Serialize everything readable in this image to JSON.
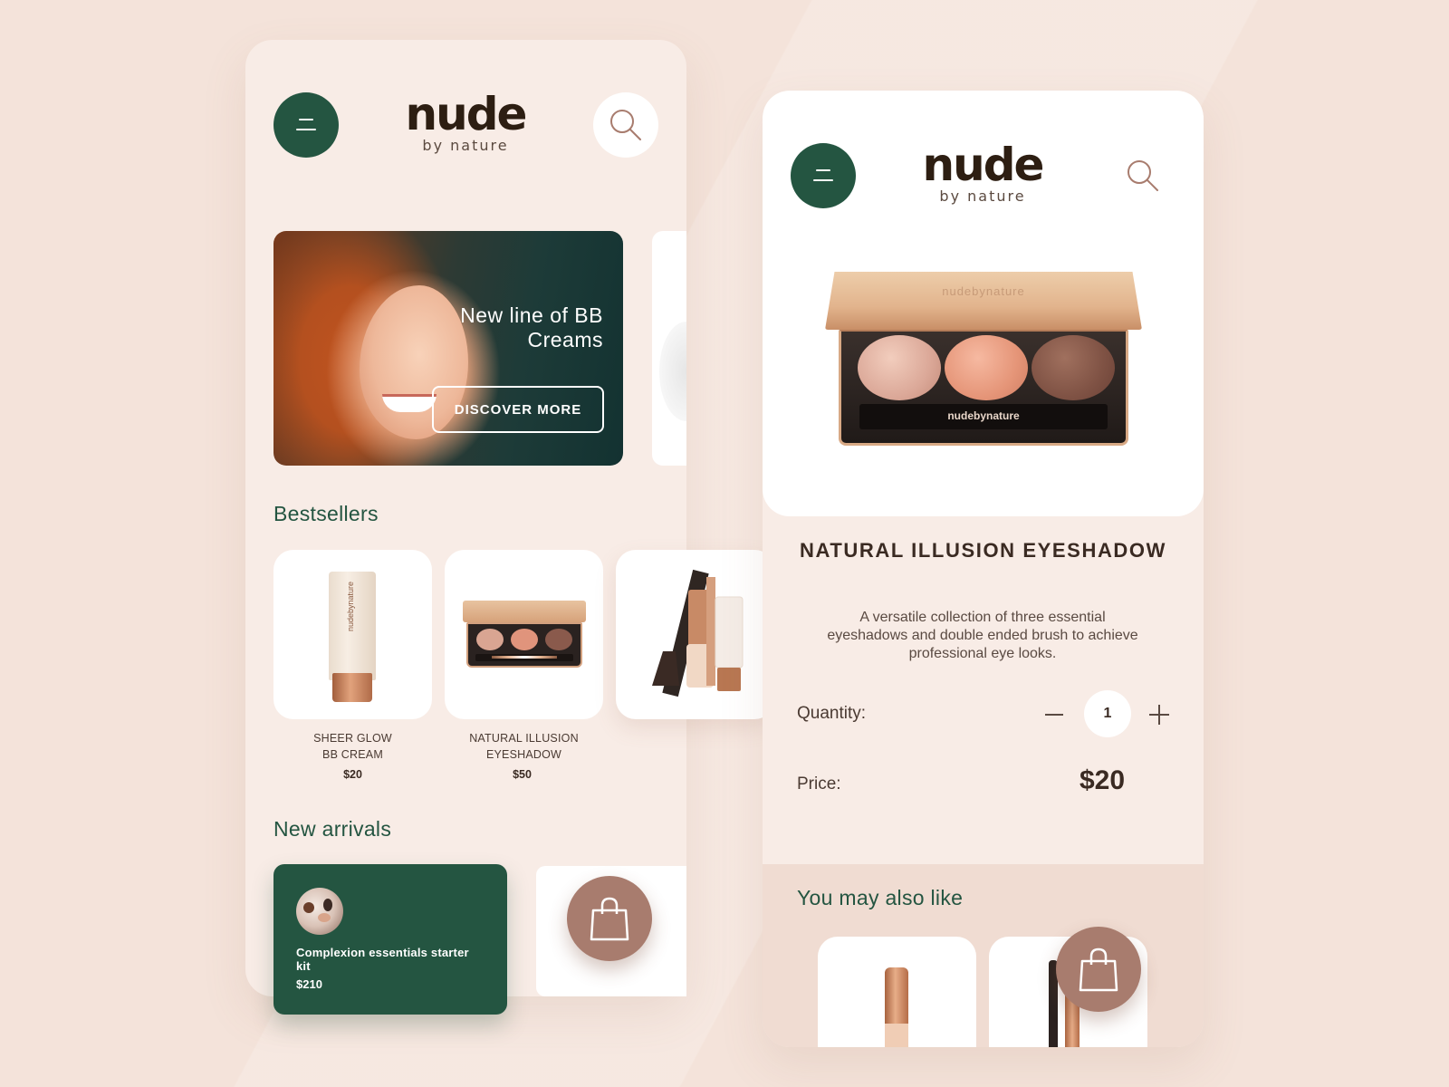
{
  "brand": {
    "name": "nude",
    "tagline": "by nature"
  },
  "home": {
    "hero": {
      "title": "New line of BB Creams",
      "cta": "DISCOVER MORE"
    },
    "bestsellers": {
      "title": "Bestsellers",
      "items": [
        {
          "name_line1": "SHEER GLOW",
          "name_line2": "BB CREAM",
          "price": "$20",
          "image_icon": "bb-cream-tube"
        },
        {
          "name_line1": "NATURAL ILLUSION",
          "name_line2": "EYESHADOW",
          "price": "$50",
          "image_icon": "eyeshadow-palette"
        },
        {
          "name_line1": "",
          "name_line2": "",
          "price": "",
          "image_icon": "makeup-set"
        }
      ]
    },
    "new_arrivals": {
      "title": "New arrivals",
      "featured": {
        "title": "Complexion essentials starter kit",
        "price": "$210"
      }
    }
  },
  "product": {
    "title": "NATURAL ILLUSION EYESHADOW",
    "description": "A versatile collection of three essential eyeshadows and double ended brush to achieve professional eye looks.",
    "lid_brand": "nudebynature",
    "brush_brand": "nudebynature",
    "quantity_label": "Quantity:",
    "quantity_value": "1",
    "price_label": "Price:",
    "price_value": "$20",
    "also_like_title": "You may also like"
  },
  "icons": {
    "menu": "menu-icon",
    "search": "search-icon",
    "bag": "shopping-bag-icon",
    "minus": "minus-icon",
    "plus": "plus-icon"
  },
  "colors": {
    "background": "#f4e3da",
    "screen": "#f8ece6",
    "brand_green": "#245541",
    "bag_button": "#a87c6e",
    "logo": "#2d1e12"
  }
}
